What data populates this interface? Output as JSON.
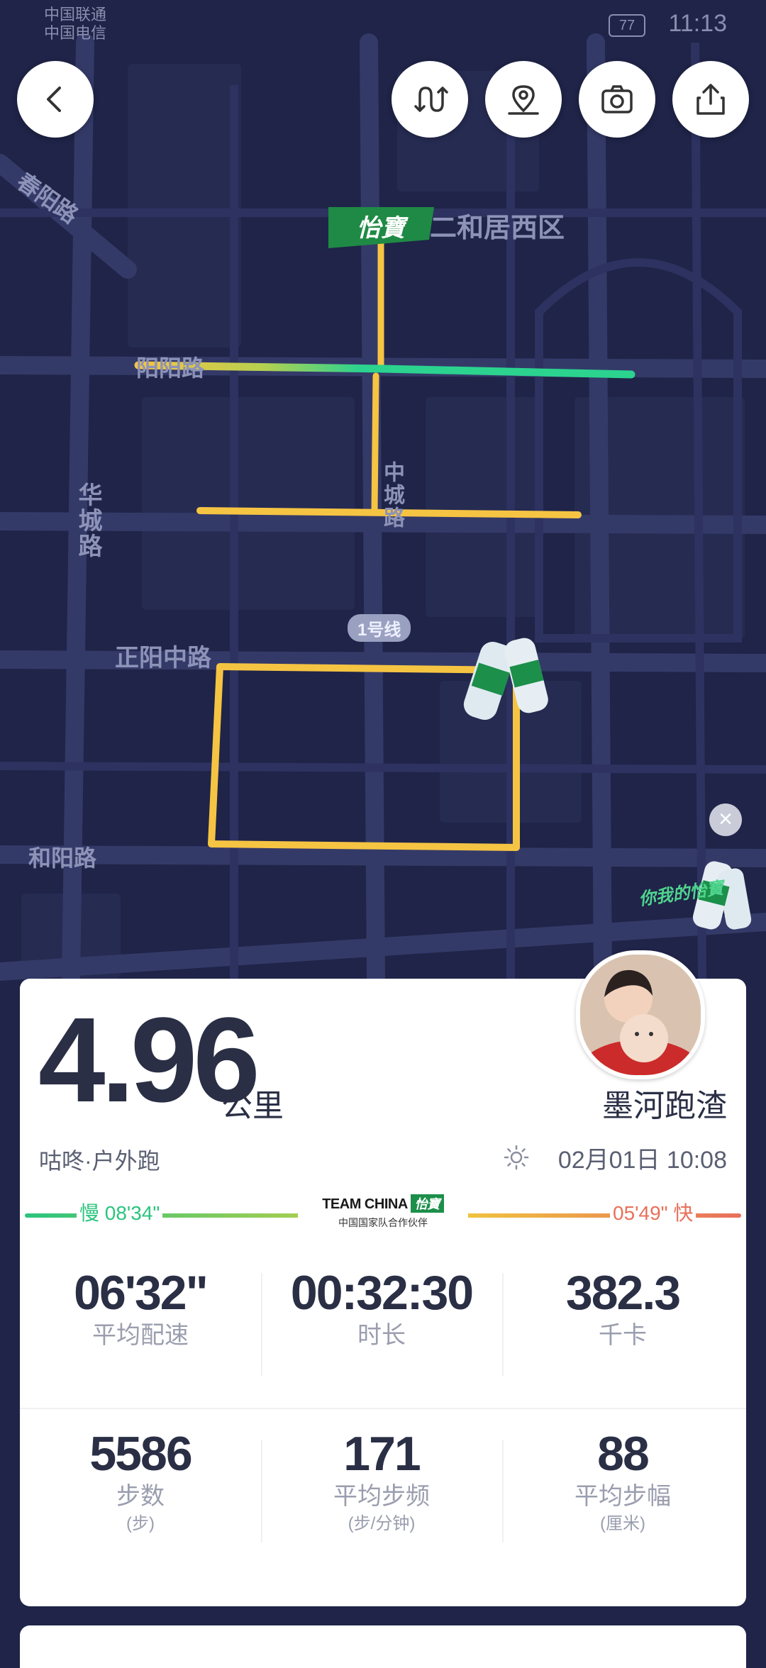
{
  "status_bar": {
    "carrier1": "中国联通",
    "carrier2": "中国电信",
    "battery": "77",
    "time": "11:13"
  },
  "toolbar": {
    "back_icon": "chevron-left-icon",
    "route_icon": "route-icon",
    "location_icon": "location-pin-icon",
    "camera_icon": "camera-icon",
    "share_icon": "share-icon"
  },
  "map": {
    "streets": [
      "春阳路",
      "阳阳路",
      "二和居西区",
      "华城路",
      "中城路",
      "正阳中路",
      "和阳路"
    ],
    "metro_tag": "1号线",
    "flag_text": "怡寶",
    "ad_text": "你我的怡寶",
    "route_colors": {
      "slow": "#f6c443",
      "fast": "#2bd38f"
    }
  },
  "summary": {
    "distance": "4.96",
    "distance_unit": "公里",
    "username": "墨河跑渣",
    "activity": "咕咚·户外跑",
    "date": "02月01日 10:08"
  },
  "pace_legend": {
    "slow_label": "慢 08'34\"",
    "fast_label": "05'49\" 快",
    "sponsor_top": "TEAM CHINA",
    "sponsor_tag": "怡寶",
    "sponsor_sub": "中国国家队合作伙伴",
    "colors": {
      "slow": "#2bc47e",
      "mid": "#f0c23f",
      "fast": "#e8705a"
    }
  },
  "stats": [
    {
      "value": "06'32\"",
      "label": "平均配速",
      "unit": ""
    },
    {
      "value": "00:32:30",
      "label": "时长",
      "unit": ""
    },
    {
      "value": "382.3",
      "label": "千卡",
      "unit": ""
    },
    {
      "value": "5586",
      "label": "步数",
      "unit": "(步)"
    },
    {
      "value": "171",
      "label": "平均步频",
      "unit": "(步/分钟)"
    },
    {
      "value": "88",
      "label": "平均步幅",
      "unit": "(厘米)"
    }
  ]
}
